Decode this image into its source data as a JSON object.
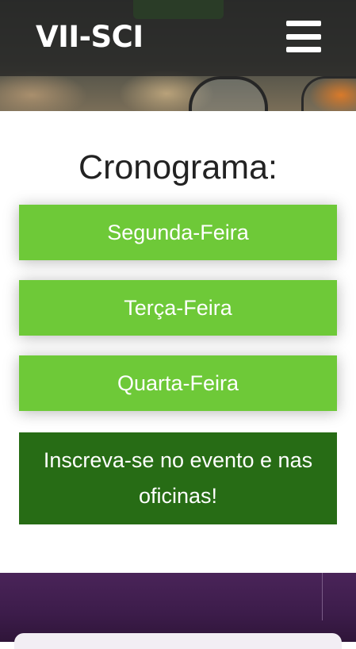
{
  "header": {
    "logo": "VII-SCI",
    "menu_icon": "hamburger-menu-icon"
  },
  "schedule": {
    "title": "Cronograma:",
    "days": [
      {
        "label": "Segunda-Feira"
      },
      {
        "label": "Terça-Feira"
      },
      {
        "label": "Quarta-Feira"
      }
    ],
    "cta_label": "Inscreva-se no evento e nas oficinas!"
  },
  "colors": {
    "day_button": "#6ec938",
    "cta_button": "#276c15",
    "footer": "#4a2459"
  }
}
